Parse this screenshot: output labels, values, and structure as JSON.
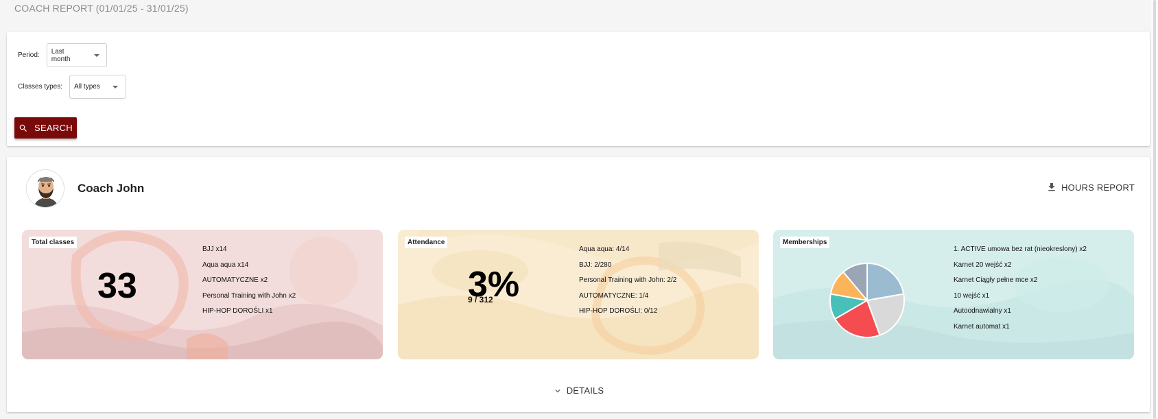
{
  "page": {
    "title": "COACH REPORT (01/01/25 - 31/01/25)"
  },
  "filters": {
    "period_label": "Period:",
    "period_value": "Last month",
    "types_label": "Classes types:",
    "types_value": "All types",
    "search_label": "SEARCH"
  },
  "coach": {
    "name": "Coach John",
    "hours_report_label": "HOURS REPORT"
  },
  "stats": {
    "total": {
      "label": "Total classes",
      "value": "33",
      "items": [
        "BJJ x14",
        "Aqua aqua x14",
        "AUTOMATYCZNE x2",
        "Personal Training with John x2",
        "HIP-HOP DOROŚLI x1"
      ]
    },
    "attendance": {
      "label": "Attendance",
      "value": "3%",
      "sub": "9 / 312",
      "items": [
        "Aqua aqua: 4/14",
        "BJJ: 2/280",
        "Personal Training with John: 2/2",
        "AUTOMATYCZNE: 1/4",
        "HIP-HOP DOROŚLI: 0/12"
      ]
    },
    "memberships": {
      "label": "Memberships",
      "items": [
        "1. ACTIVE umowa bez rat (nieokreslony) x2",
        "Karnet 20 wejść x2",
        "Karnet Ciągły pełne mce x2",
        "10 wejść x1",
        "Autoodnawialny x1",
        "Karnet automat x1"
      ]
    }
  },
  "chart_data": {
    "type": "pie",
    "categories": [
      "1. ACTIVE umowa bez rat (nieokreslony)",
      "Karnet 20 wejść",
      "Karnet Ciągły pełne mce",
      "10 wejść",
      "Autoodnawialny",
      "Karnet automat"
    ],
    "values": [
      2,
      2,
      2,
      1,
      1,
      1
    ],
    "colors": [
      "#9bbbd0",
      "#d9d9d9",
      "#f54c52",
      "#47c0b9",
      "#fbb45a",
      "#9aa5b5"
    ]
  },
  "details_label": "DETAILS",
  "colors": {
    "accent": "#7a0a0a"
  },
  "icons": {
    "search": "search-icon",
    "download": "download-icon",
    "chevron": "chevron-down-icon"
  }
}
